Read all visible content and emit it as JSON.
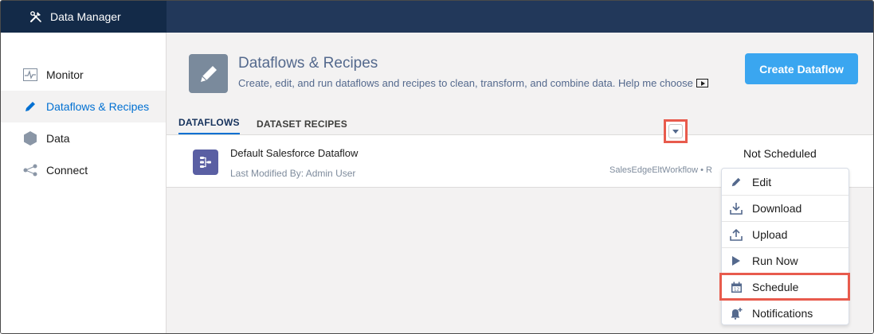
{
  "app": {
    "title": "Data Manager"
  },
  "sidebar": {
    "items": [
      {
        "label": "Monitor",
        "icon": "monitor-icon",
        "active": false
      },
      {
        "label": "Dataflows & Recipes",
        "icon": "pencil-icon",
        "active": true
      },
      {
        "label": "Data",
        "icon": "hexagon-icon",
        "active": false
      },
      {
        "label": "Connect",
        "icon": "share-icon",
        "active": false
      }
    ]
  },
  "header": {
    "title": "Dataflows & Recipes",
    "subtitle": "Create, edit, and run dataflows and recipes to clean, transform, and combine data. Help me choose",
    "create_button": "Create Dataflow",
    "icon": "pencil-icon"
  },
  "tabs": [
    {
      "label": "DATAFLOWS",
      "active": true
    },
    {
      "label": "DATASET RECIPES",
      "active": false
    }
  ],
  "dataflows": [
    {
      "name": "Default Salesforce Dataflow",
      "modified": "Last Modified By: Admin User",
      "status": "Not Scheduled",
      "workflow": "SalesEdgeEltWorkflow • R"
    }
  ],
  "menu": {
    "items": [
      {
        "label": "Edit",
        "icon": "pencil-icon"
      },
      {
        "label": "Download",
        "icon": "download-icon"
      },
      {
        "label": "Upload",
        "icon": "upload-icon"
      },
      {
        "label": "Run Now",
        "icon": "play-icon"
      },
      {
        "label": "Schedule",
        "icon": "calendar-icon"
      },
      {
        "label": "Notifications",
        "icon": "bell-icon"
      }
    ]
  },
  "colors": {
    "topbar": "#22385a",
    "brand": "#132a48",
    "accent": "#0070d2",
    "button": "#3aa6f0",
    "highlight": "#e85b4d",
    "dataflow_icon": "#5a5fa3"
  }
}
